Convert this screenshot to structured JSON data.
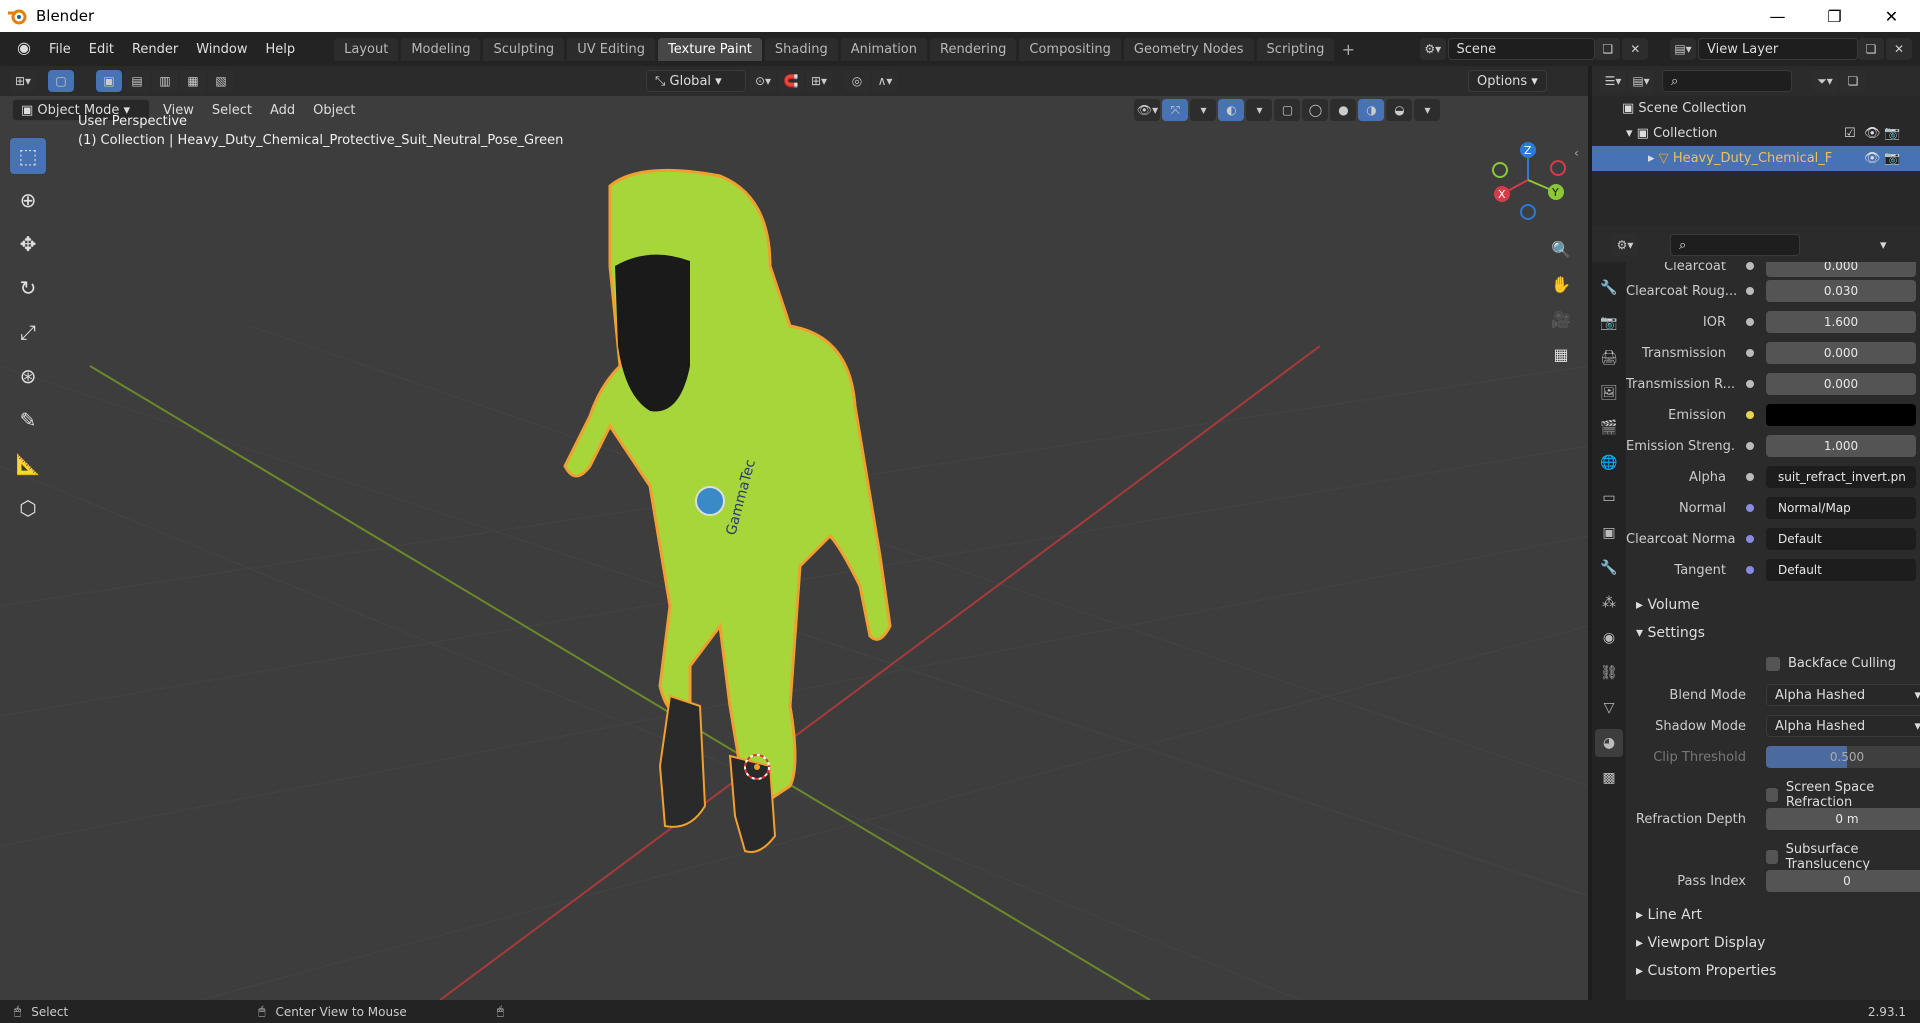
{
  "window": {
    "title": "Blender"
  },
  "menu": [
    "File",
    "Edit",
    "Render",
    "Window",
    "Help"
  ],
  "workspaces": [
    "Layout",
    "Modeling",
    "Sculpting",
    "UV Editing",
    "Texture Paint",
    "Shading",
    "Animation",
    "Rendering",
    "Compositing",
    "Geometry Nodes",
    "Scripting"
  ],
  "active_workspace": "Texture Paint",
  "scene": {
    "name": "Scene",
    "view_layer": "View Layer"
  },
  "viewport": {
    "transform_orientation": "Global",
    "options_label": "Options",
    "mode": "Object Mode",
    "header_menus": [
      "View",
      "Select",
      "Add",
      "Object"
    ],
    "perspective": "User Perspective",
    "collection_info": "(1) Collection | Heavy_Duty_Chemical_Protective_Suit_Neutral_Pose_Green",
    "suit_brand": "GammaTec"
  },
  "gizmo": {
    "x": "X",
    "y": "Y",
    "z": "Z"
  },
  "outliner": {
    "scene_collection": "Scene Collection",
    "collection": "Collection",
    "object": "Heavy_Duty_Chemical_F"
  },
  "properties": {
    "rows": [
      {
        "label": "Clearcoat",
        "value": "0.000"
      },
      {
        "label": "Clearcoat Roug...",
        "value": "0.030"
      },
      {
        "label": "IOR",
        "value": "1.600"
      },
      {
        "label": "Transmission",
        "value": "0.000"
      },
      {
        "label": "Transmission R...",
        "value": "0.000"
      },
      {
        "label": "Emission",
        "value": ""
      },
      {
        "label": "Emission Streng...",
        "value": "1.000"
      },
      {
        "label": "Alpha",
        "value": "suit_refract_invert.pn"
      },
      {
        "label": "Normal",
        "value": "Normal/Map"
      },
      {
        "label": "Clearcoat Normal",
        "value": "Default"
      },
      {
        "label": "Tangent",
        "value": "Default"
      }
    ],
    "section_volume": "Volume",
    "section_settings": "Settings",
    "backface_culling": "Backface Culling",
    "blend_mode_label": "Blend Mode",
    "blend_mode": "Alpha Hashed",
    "shadow_mode_label": "Shadow Mode",
    "shadow_mode": "Alpha Hashed",
    "clip_threshold_label": "Clip Threshold",
    "clip_threshold": "0.500",
    "screen_space_refraction": "Screen Space Refraction",
    "refraction_depth_label": "Refraction Depth",
    "refraction_depth": "0 m",
    "subsurface_translucency": "Subsurface Translucency",
    "pass_index_label": "Pass Index",
    "pass_index": "0",
    "section_line_art": "Line Art",
    "section_viewport_display": "Viewport Display",
    "section_custom_properties": "Custom Properties"
  },
  "statusbar": {
    "select": "Select",
    "center_view": "Center View to Mouse",
    "version": "2.93.1"
  }
}
